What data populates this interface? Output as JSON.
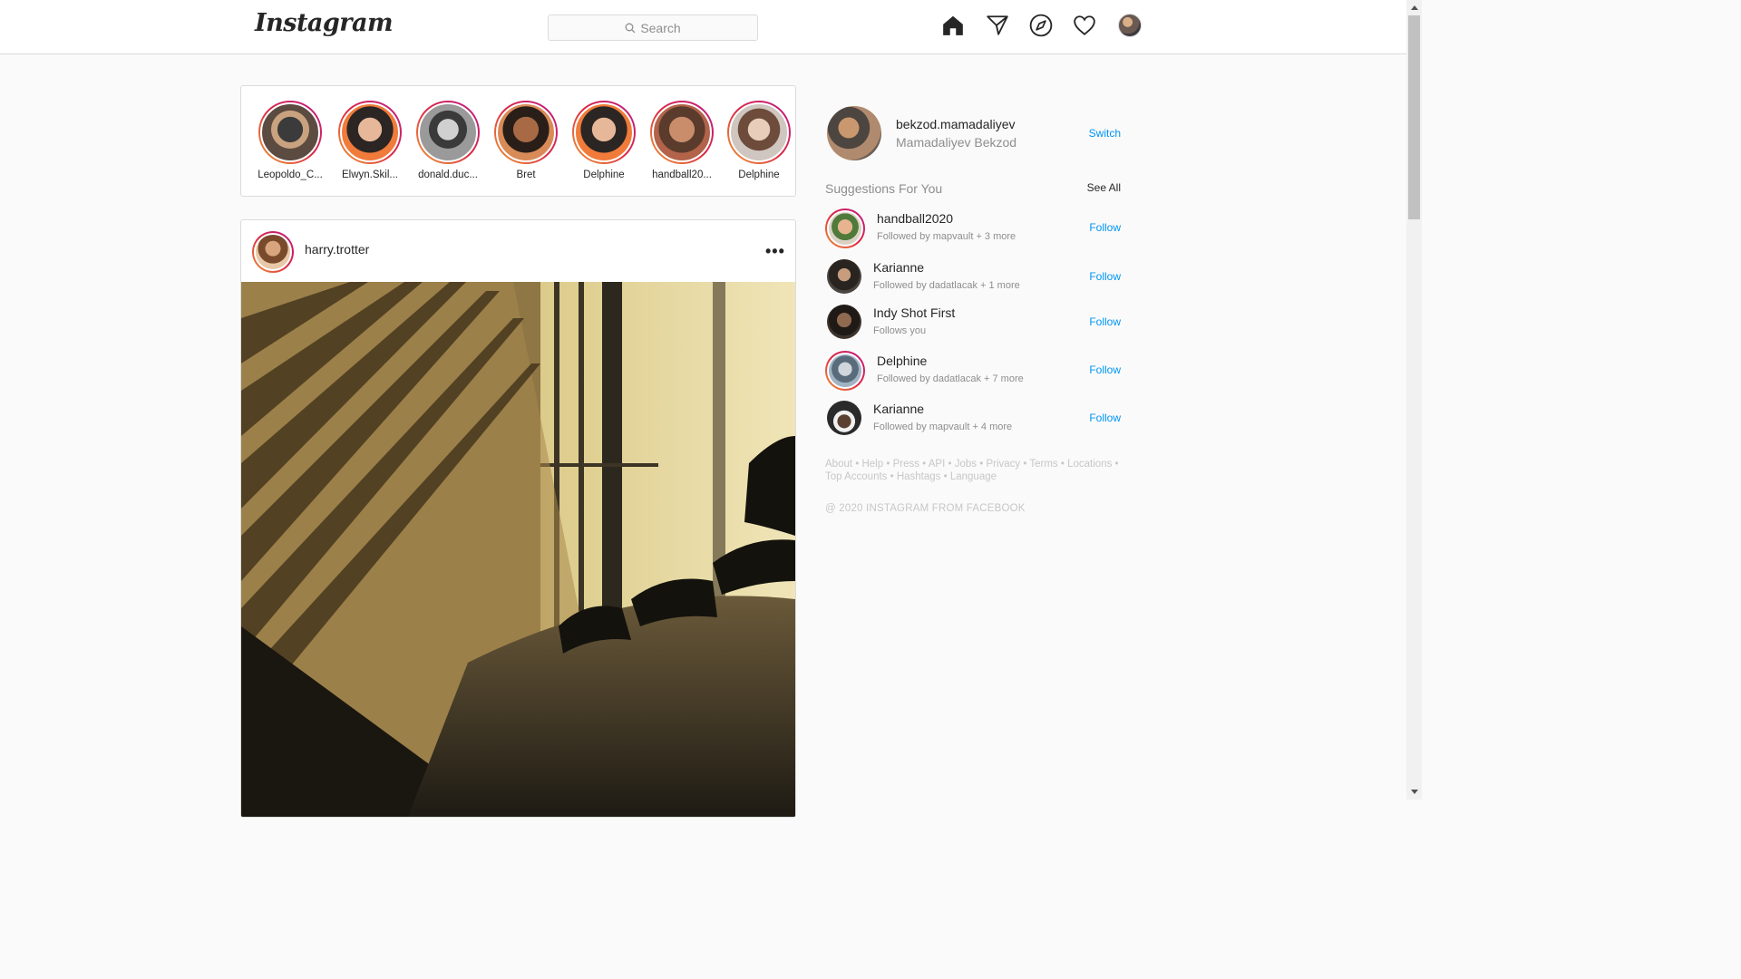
{
  "header": {
    "logo": "Instagram",
    "search_placeholder": "Search",
    "icons": [
      "home-icon",
      "direct-icon",
      "explore-icon",
      "activity-icon",
      "profile-avatar"
    ]
  },
  "stories": [
    {
      "name": "Leopoldo_C..."
    },
    {
      "name": "Elwyn.Skil..."
    },
    {
      "name": "donald.duc..."
    },
    {
      "name": "Bret"
    },
    {
      "name": "Delphine"
    },
    {
      "name": "handball20..."
    },
    {
      "name": "Delphine"
    }
  ],
  "post": {
    "username": "harry.trotter",
    "more": "•••"
  },
  "me": {
    "username": "bekzod.mamadaliyev",
    "full_name": "Mamadaliyev Bekzod",
    "switch_label": "Switch"
  },
  "suggestions": {
    "title": "Suggestions For You",
    "see_all": "See All",
    "follow_label": "Follow",
    "items": [
      {
        "name": "handball2020",
        "sub": "Followed by mapvault + 3 more"
      },
      {
        "name": "Karianne",
        "sub": "Followed by dadatlacak + 1 more"
      },
      {
        "name": "Indy Shot First",
        "sub": "Follows you"
      },
      {
        "name": "Delphine",
        "sub": "Followed by dadatlacak + 7 more"
      },
      {
        "name": "Karianne",
        "sub": "Followed by mapvault + 4 more"
      }
    ]
  },
  "footer": {
    "links": [
      "About",
      "Help",
      "Press",
      "API",
      "Jobs",
      "Privacy",
      "Terms",
      "Locations",
      "Top Accounts",
      "Hashtags",
      "Language"
    ],
    "copyright": "@ 2020 INSTAGRAM FROM FACEBOOK"
  },
  "colors": {
    "accent": "#0095f6",
    "story_ring": "#dc2743",
    "border": "#dbdbdb",
    "background": "#fafafa"
  }
}
